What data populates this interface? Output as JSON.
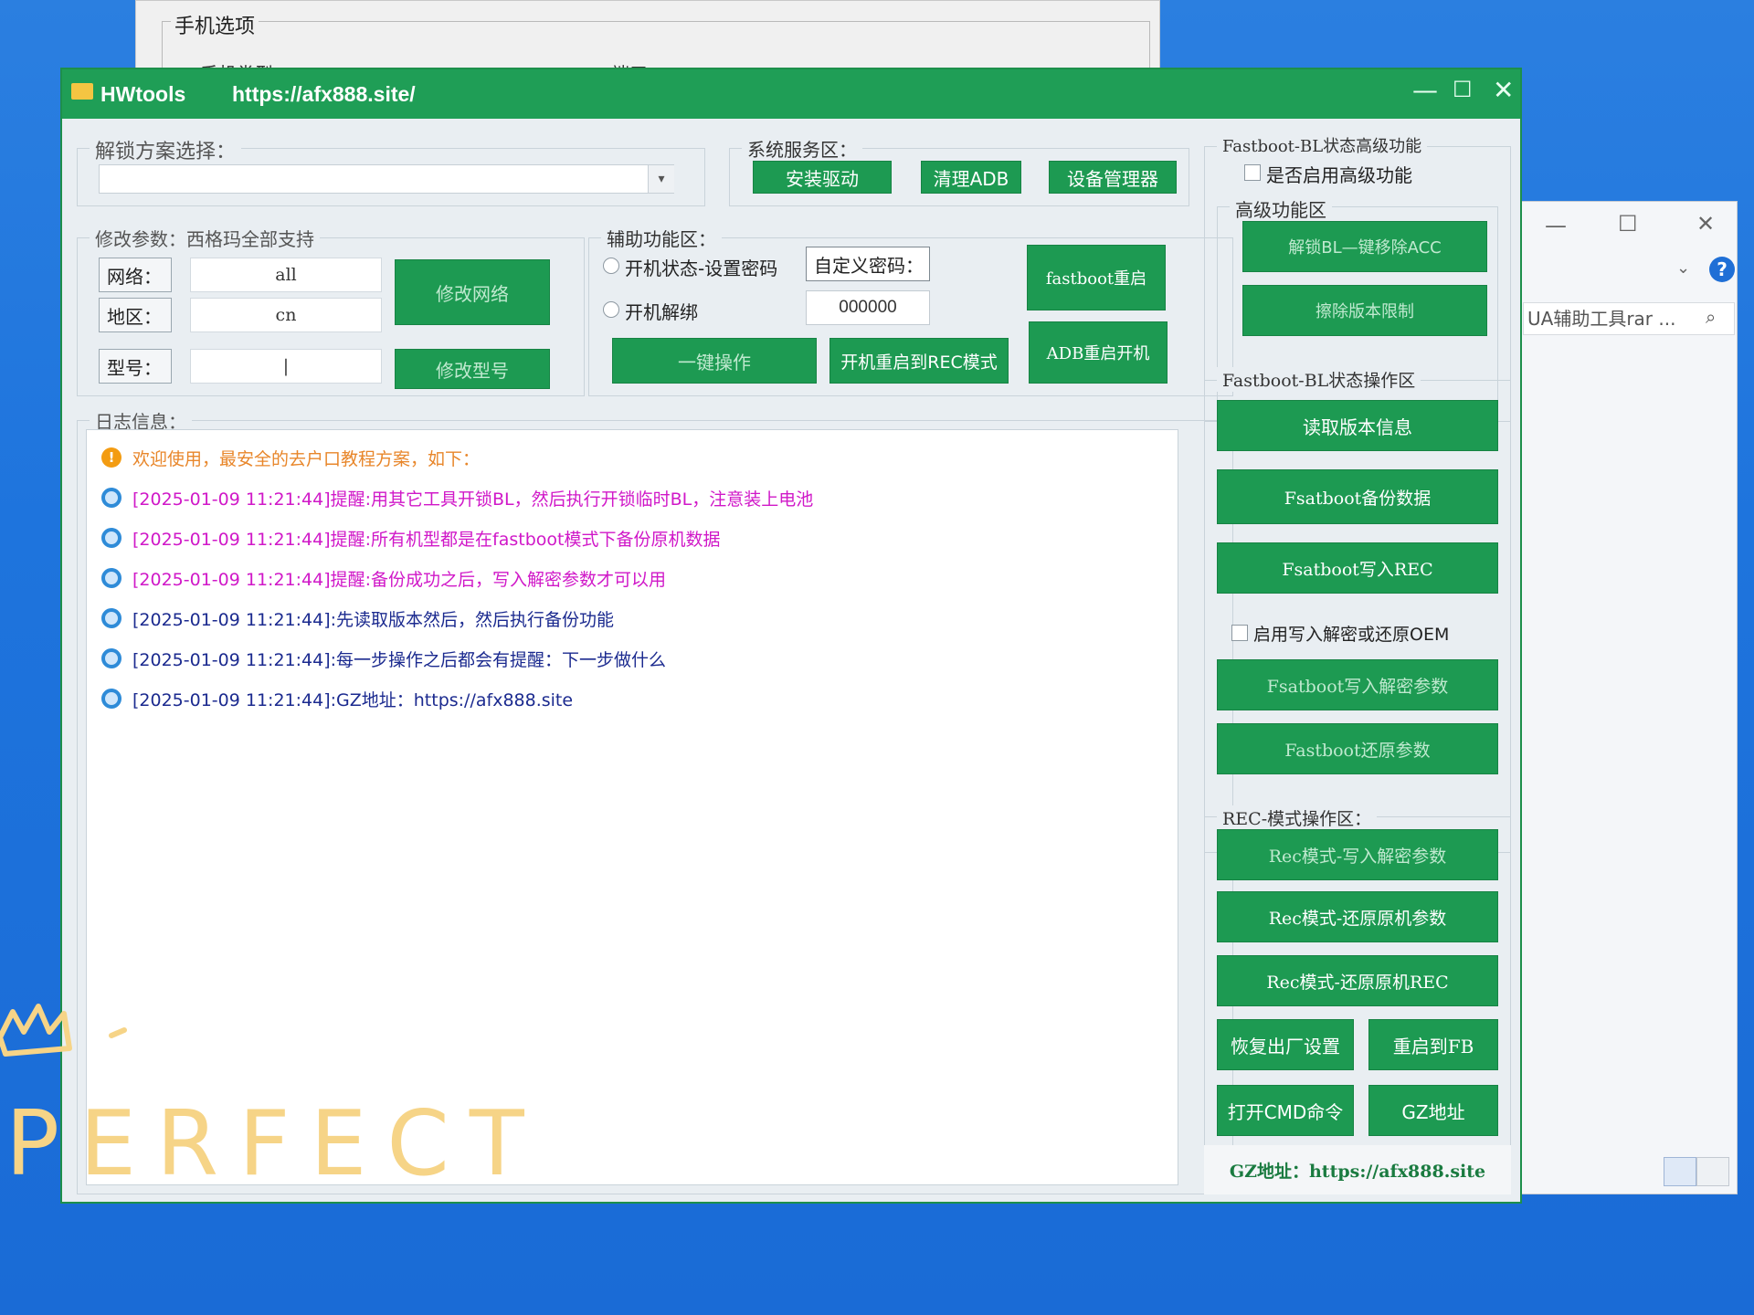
{
  "background_window": {
    "group_title": "手机选项",
    "partial_label_1": "手机类型",
    "partial_label_2": "端口"
  },
  "explorer_window": {
    "search_text": "UA辅助工具rar ...",
    "help_icon_text": "?"
  },
  "app": {
    "title": "HWtools",
    "url": "https://afx888.site/",
    "unlock_scheme": {
      "label": "解锁方案选择：",
      "value": ""
    },
    "system_service": {
      "label": "系统服务区：",
      "buttons": [
        "安装驱动",
        "清理ADB",
        "设备管理器"
      ]
    },
    "modify_params": {
      "label": "修改参数：西格玛全部支持",
      "network_label": "网络：",
      "network_value": "all",
      "region_label": "地区：",
      "region_value": "cn",
      "model_label": "型号：",
      "model_value": "|",
      "modify_network_button": "修改网络",
      "modify_model_button": "修改型号"
    },
    "aux": {
      "label": "辅助功能区：",
      "radio_set_password": "开机状态-设置密码",
      "radio_unbind": "开机解绑",
      "custom_password_label": "自定义密码：",
      "password_value": "000000",
      "one_click_button": "一键操作",
      "reboot_rec_button": "开机重启到REC模式",
      "fastboot_reboot_button": "fastboot重启",
      "adb_reboot_button": "ADB重启开机"
    },
    "log": {
      "label": "日志信息：",
      "lines": [
        {
          "type": "warn",
          "text": "欢迎使用，最安全的去户口教程方案，如下：",
          "color": "#e8862a"
        },
        {
          "type": "info",
          "text": "[2025-01-09 11:21:44]提醒:用其它工具开锁BL，然后执行开锁临时BL，注意装上电池",
          "color": "#d018c8"
        },
        {
          "type": "info",
          "text": "[2025-01-09 11:21:44]提醒:所有机型都是在fastboot模式下备份原机数据",
          "color": "#d018c8"
        },
        {
          "type": "info",
          "text": "[2025-01-09 11:21:44]提醒:备份成功之后，写入解密参数才可以用",
          "color": "#d018c8"
        },
        {
          "type": "info",
          "text": "[2025-01-09 11:21:44]:先读取版本然后，然后执行备份功能",
          "color": "#1b2a8f"
        },
        {
          "type": "info",
          "text": "[2025-01-09 11:21:44]:每一步操作之后都会有提醒：下一步做什么",
          "color": "#1b2a8f"
        },
        {
          "type": "info",
          "text": "[2025-01-09 11:21:44]:GZ地址：https://afx888.site",
          "color": "#1b2a8f"
        }
      ]
    },
    "fastboot_advanced": {
      "label": "Fastboot-BL状态高级功能",
      "enable_checkbox": "是否启用高级功能",
      "sub_label": "高级功能区",
      "buttons": [
        "解锁BL—键移除ACC",
        "擦除版本限制"
      ]
    },
    "fastboot_ops": {
      "label": "Fastboot-BL状态操作区",
      "read_version": "读取版本信息",
      "backup": "Fsatboot备份数据",
      "write_rec": "Fsatboot写入REC",
      "enable_write_checkbox": "启用写入解密或还原OEM",
      "write_decrypt": "Fsatboot写入解密参数",
      "restore_params": "Fastboot还原参数"
    },
    "rec_ops": {
      "label": "REC-模式操作区：",
      "write_decrypt": "Rec模式-写入解密参数",
      "restore_params": "Rec模式-还原原机参数",
      "restore_rec": "Rec模式-还原原机REC",
      "factory_reset": "恢复出厂设置",
      "reboot_fb": "重启到FB",
      "open_cmd": "打开CMD命令",
      "gz_address_button": "GZ地址"
    },
    "footer": "GZ地址：https://afx888.site"
  },
  "overlay": {
    "text": "PERFECT"
  },
  "colors": {
    "accent_green": "#1d9a52",
    "title_green": "#1f9e56",
    "desktop_blue": "#2277dd"
  }
}
